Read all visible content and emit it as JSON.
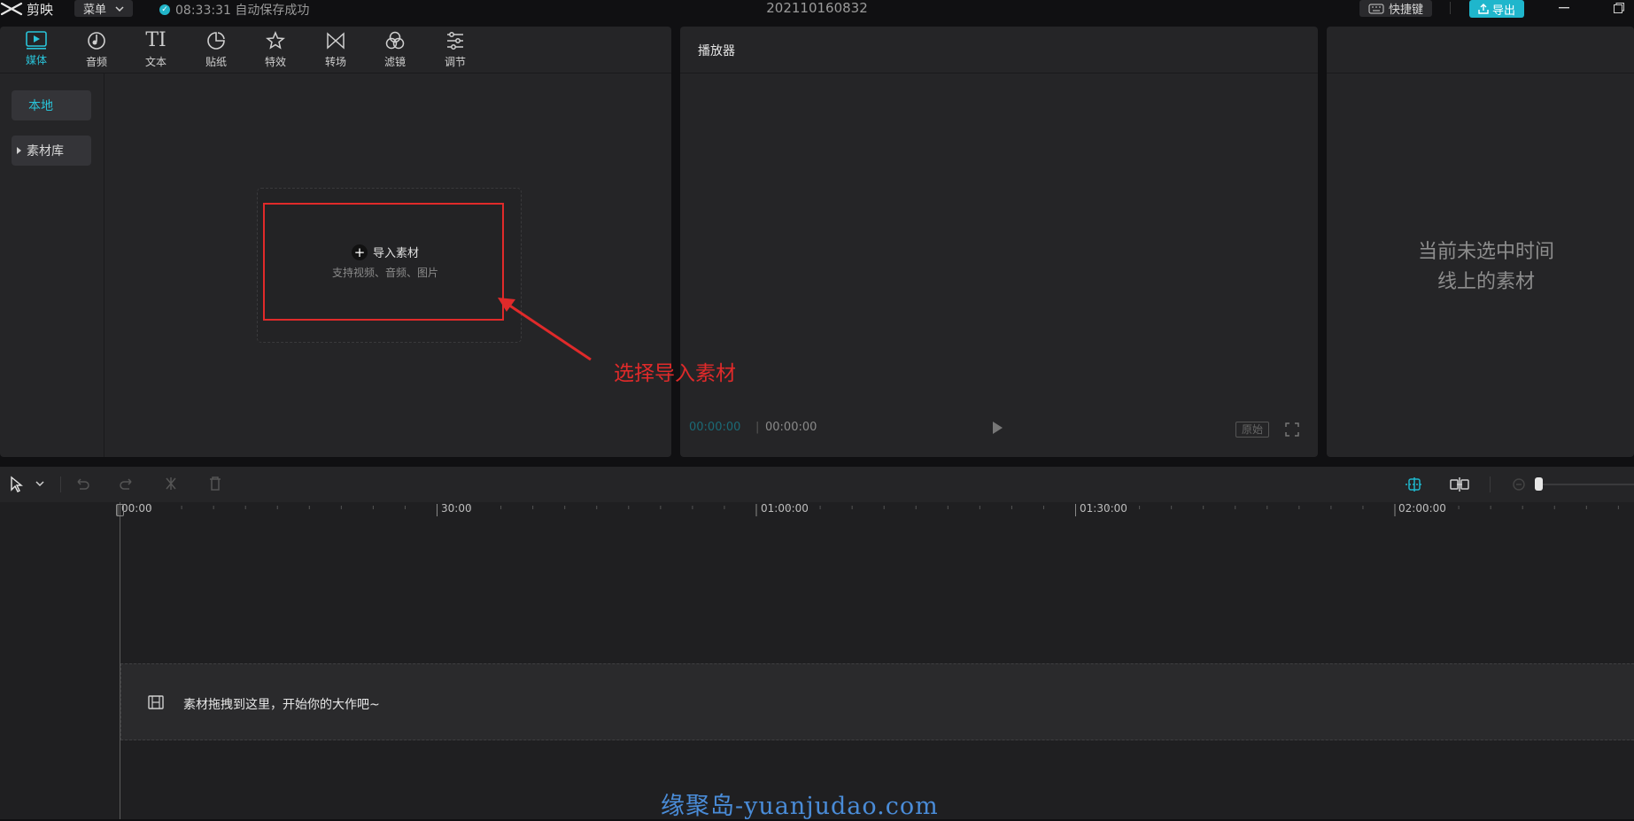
{
  "titlebar": {
    "app_name": "剪映",
    "menu_label": "菜单",
    "autosave_text": "08:33:31 自动保存成功",
    "project_name": "202110160832",
    "shortcut_label": "快捷键",
    "export_label": "导出"
  },
  "toolbar": {
    "tools": [
      {
        "label": "媒体",
        "icon": "media-icon"
      },
      {
        "label": "音频",
        "icon": "audio-icon"
      },
      {
        "label": "文本",
        "icon": "text-icon"
      },
      {
        "label": "贴纸",
        "icon": "sticker-icon"
      },
      {
        "label": "特效",
        "icon": "effects-icon"
      },
      {
        "label": "转场",
        "icon": "transition-icon"
      },
      {
        "label": "滤镜",
        "icon": "filter-icon"
      },
      {
        "label": "调节",
        "icon": "adjust-icon"
      }
    ]
  },
  "sidebar": {
    "local_label": "本地",
    "library_label": "素材库"
  },
  "import": {
    "label": "导入素材",
    "hint": "支持视频、音频、图片"
  },
  "player": {
    "title": "播放器",
    "time_current": "00:00:00",
    "time_sep": "|",
    "time_total": "00:00:00",
    "ratio_label": "原始"
  },
  "props": {
    "empty_line1": "当前未选中时间",
    "empty_line2": "线上的素材"
  },
  "timeline": {
    "ticks": [
      "00:00",
      "30:00",
      "01:00:00",
      "01:30:00",
      "02:00:00"
    ],
    "drop_hint": "素材拖拽到这里，开始你的大作吧~"
  },
  "annotation": "选择导入素材",
  "watermark": "缘聚岛-yuanjudao.com",
  "colors": {
    "accent": "#1fb6cc",
    "annotation_red": "#e02a2a",
    "panel_bg": "#252527"
  }
}
